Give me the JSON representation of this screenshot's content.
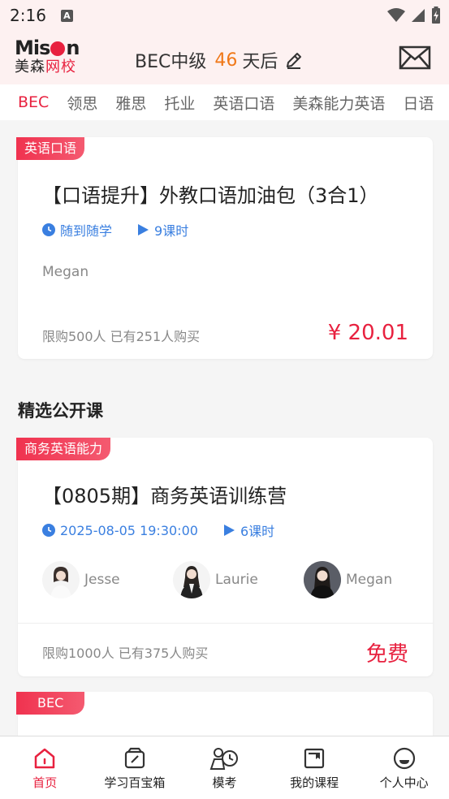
{
  "status": {
    "time": "2:16",
    "a_badge": "A"
  },
  "header": {
    "logo_top": "Mison",
    "logo_bottom_black": "美森",
    "logo_bottom_red": "网校",
    "exam": "BEC中级",
    "days": "46",
    "days_suffix": "天后",
    "accent": "#e8213f"
  },
  "tabs": [
    "BEC",
    "领思",
    "雅思",
    "托业",
    "英语口语",
    "美森能力英语",
    "日语"
  ],
  "course_card": {
    "tag": "英语口语",
    "title": "【口语提升】外教口语加油包（3合1）",
    "time_label": "随到随学",
    "lessons": "9课时",
    "teacher": "Megan",
    "buy_info": "限购500人  已有251人购买",
    "price": "¥ 20.01"
  },
  "section_title": "精选公开课",
  "open_card": {
    "tag": "商务英语能力",
    "title": "【0805期】商务英语训练营",
    "time_label": "2025-08-05 19:30:00",
    "lessons": "6课时",
    "teachers": [
      "Jesse",
      "Laurie",
      "Megan"
    ],
    "buy_info": "限购1000人  已有375人购买",
    "price": "免费"
  },
  "third_card": {
    "tag": "BEC"
  },
  "bottom_nav": [
    {
      "label": "首页",
      "icon": "home-icon"
    },
    {
      "label": "学习百宝箱",
      "icon": "toolbox-icon"
    },
    {
      "label": "模考",
      "icon": "mock-exam-icon"
    },
    {
      "label": "我的课程",
      "icon": "my-courses-icon"
    },
    {
      "label": "个人中心",
      "icon": "profile-icon"
    }
  ]
}
